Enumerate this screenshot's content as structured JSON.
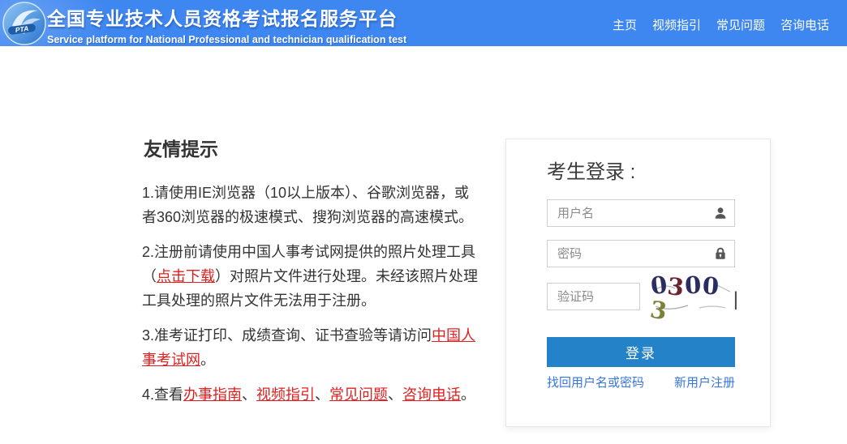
{
  "header": {
    "logo_text": "PTA",
    "title_zh": "全国专业技术人员资格考试报名服务平台",
    "title_en": "Service platform for National Professional and technician qualification test",
    "nav": [
      {
        "id": "home",
        "label": "主页"
      },
      {
        "id": "video-guide",
        "label": "视频指引"
      },
      {
        "id": "faq",
        "label": "常见问题"
      },
      {
        "id": "phone",
        "label": "咨询电话"
      }
    ]
  },
  "tips": {
    "heading": "友情提示",
    "items": [
      {
        "segments": [
          {
            "t": "1.请使用IE浏览器（10以上版本）、谷歌浏览器，或\n者360浏览器的极速模式、搜狗浏览器的高速模式。"
          }
        ]
      },
      {
        "segments": [
          {
            "t": "2.注册前请使用中国人事考试网提供的照片处理工具\n（"
          },
          {
            "t": "点击下载",
            "link": true
          },
          {
            "t": "）对照片文件进行处理。未经该照片处理\n工具处理的照片文件无法用于注册。"
          }
        ]
      },
      {
        "segments": [
          {
            "t": "3.准考证打印、成绩查询、证书查验等请访问"
          },
          {
            "t": "中国人\n事考试网",
            "link": true
          },
          {
            "t": "。"
          }
        ]
      },
      {
        "segments": [
          {
            "t": "4.查看"
          },
          {
            "t": "办事指南",
            "link": true
          },
          {
            "t": "、"
          },
          {
            "t": "视频指引",
            "link": true
          },
          {
            "t": "、"
          },
          {
            "t": "常见问题",
            "link": true
          },
          {
            "t": "、"
          },
          {
            "t": "咨询电话",
            "link": true
          },
          {
            "t": "。"
          }
        ]
      }
    ]
  },
  "login": {
    "title": "考生登录 :",
    "username_placeholder": "用户名",
    "password_placeholder": "密码",
    "captcha_placeholder": "验证码",
    "captcha": {
      "value": "03003",
      "caret": "|",
      "digits": [
        {
          "char": "0",
          "color": "#2a2d60"
        },
        {
          "char": "3",
          "color": "#6b2430"
        },
        {
          "char": "0",
          "color": "#2a2d60"
        },
        {
          "char": "0",
          "color": "#2a2d60"
        },
        {
          "char": "3",
          "color": "#7e8038"
        }
      ]
    },
    "button_label": "登录",
    "forgot_label": "找回用户名或密码",
    "register_label": "新用户注册"
  },
  "colors": {
    "header_blue": "#3e86f0",
    "button_blue": "#2483c8",
    "link_blue": "#3777d9",
    "red_link": "#e02020",
    "text": "#333333"
  }
}
